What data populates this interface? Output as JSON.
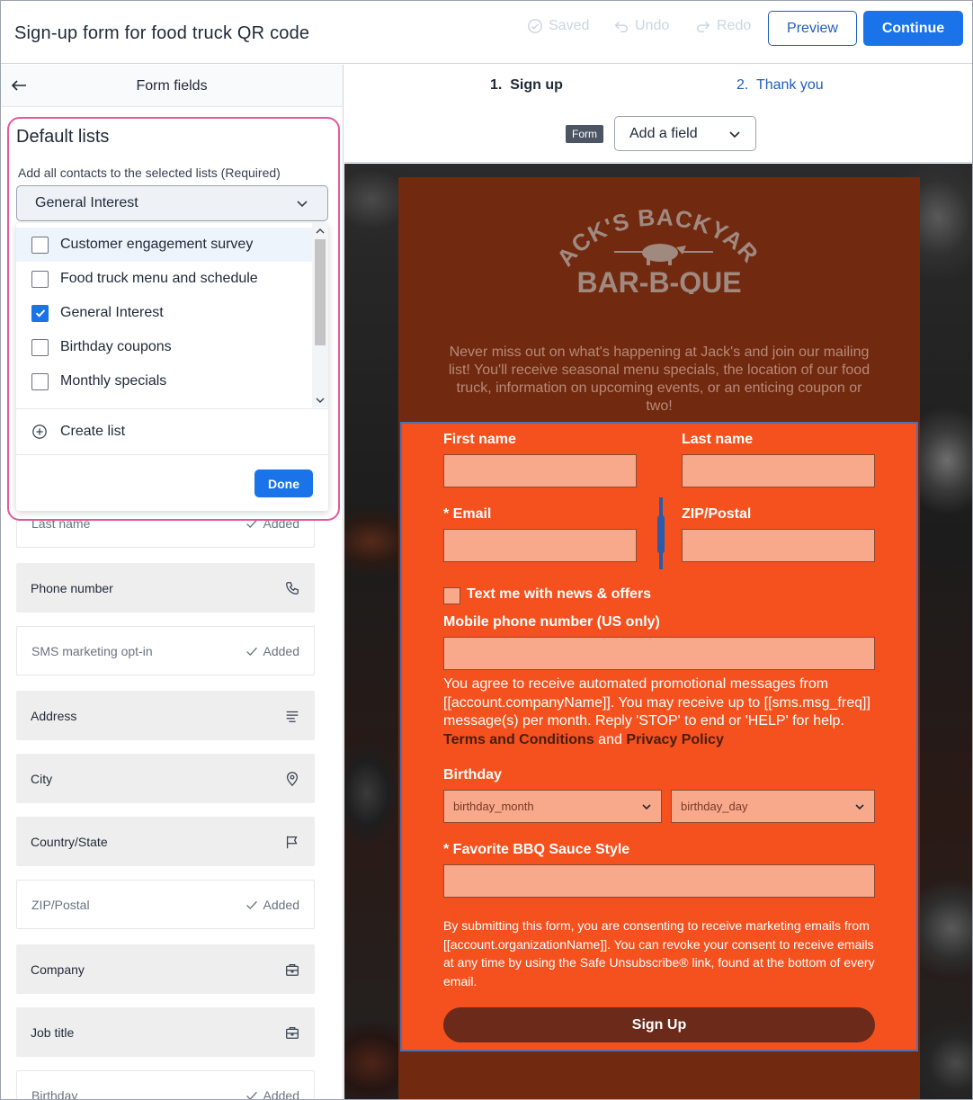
{
  "header": {
    "title": "Sign-up form for food truck QR code",
    "saved_label": "Saved",
    "undo_label": "Undo",
    "redo_label": "Redo",
    "preview_label": "Preview",
    "continue_label": "Continue"
  },
  "left_panel": {
    "title": "Form fields",
    "fields": [
      {
        "label": "Last name",
        "status": "Added",
        "icon": "check-icon"
      },
      {
        "label": "Phone number",
        "status": "",
        "icon": "phone-icon"
      },
      {
        "label": "SMS marketing opt-in",
        "status": "Added",
        "icon": "check-icon"
      },
      {
        "label": "Address",
        "status": "",
        "icon": "address-icon"
      },
      {
        "label": "City",
        "status": "",
        "icon": "location-pin-icon"
      },
      {
        "label": "Country/State",
        "status": "",
        "icon": "flag-icon"
      },
      {
        "label": "ZIP/Postal",
        "status": "Added",
        "icon": "check-icon"
      },
      {
        "label": "Company",
        "status": "",
        "icon": "briefcase-icon"
      },
      {
        "label": "Job title",
        "status": "",
        "icon": "briefcase-icon"
      },
      {
        "label": "Birthday",
        "status": "Added",
        "icon": "check-icon"
      }
    ]
  },
  "default_lists": {
    "title": "Default lists",
    "subtitle": "Add all contacts to the selected lists (Required)",
    "selected": "General Interest",
    "options": [
      {
        "label": "Customer engagement survey",
        "checked": false
      },
      {
        "label": "Food truck menu and schedule",
        "checked": false
      },
      {
        "label": "General Interest",
        "checked": true
      },
      {
        "label": "Birthday coupons",
        "checked": false
      },
      {
        "label": "Monthly specials",
        "checked": false
      }
    ],
    "create_label": "Create list",
    "done_label": "Done"
  },
  "steps": {
    "step1": "1.  Sign up",
    "step2": "2.  Thank you",
    "form_tag": "Form",
    "add_field_label": "Add a field"
  },
  "form": {
    "logo_line1": "JACK'S BACKYARD",
    "logo_line2": "BAR-B-QUE",
    "intro": "Never miss out on what's happening at Jack's and join our mailing list! You'll receive seasonal menu specials, the location of our food truck, information on upcoming events, or an enticing coupon or two!",
    "first_name": "First name",
    "last_name": "Last name",
    "email": "* Email",
    "zip": "ZIP/Postal",
    "sms_checkbox": "Text me with news & offers",
    "mobile_label": "Mobile phone number (US only)",
    "sms_text": "You agree to receive automated promotional messages from [[account.companyName]]. You may receive up to [[sms.msg_freq]] message(s) per month. Reply 'STOP' to end or 'HELP' for help.",
    "terms": "Terms and Conditions",
    "and": "and",
    "privacy": "Privacy Policy",
    "birthday_label": "Birthday",
    "birthday_month": "birthday_month",
    "birthday_day": "birthday_day",
    "bbq_label": "* Favorite BBQ Sauce Style",
    "consent": "By submitting this form, you are consenting to receive marketing emails from [[account.organizationName]]. You can revoke your consent to receive emails at any time by using the Safe Unsubscribe® link, found at the bottom of every email.",
    "submit_label": "Sign Up"
  },
  "colors": {
    "accent": "#1a73e8",
    "highlight_ring": "#e8579a",
    "form_bg": "#f4511e",
    "card_bg": "#712910"
  }
}
